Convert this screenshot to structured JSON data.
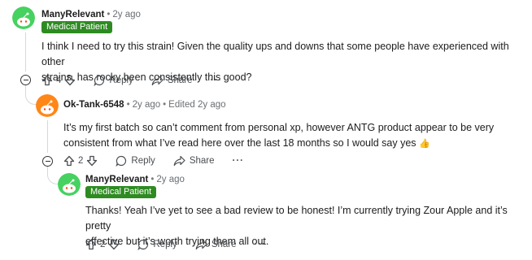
{
  "comments": [
    {
      "username": "ManyRelevant",
      "separator": "•",
      "time": "2y ago",
      "flair": "Medical Patient",
      "text_lines": [
        "I think I need to try this strain! Given the quality ups and downs that some people have experienced with other",
        "strains, has rocky been consistently this good?"
      ],
      "votes": "4",
      "reply_label": "Reply",
      "share_label": "Share",
      "more_label": "···",
      "avatar_color": "#46d160"
    },
    {
      "username": "Ok-Tank-6548",
      "separator": "•",
      "time": "2y ago",
      "edited": "Edited 2y ago",
      "text_lines": [
        "It’s my first batch so can’t comment from personal xp, however ANTG product appear to be very",
        "consistent from what I’ve read here over the last 18 months so I would say yes"
      ],
      "emoji": "👍",
      "votes": "2",
      "reply_label": "Reply",
      "share_label": "Share",
      "more_label": "···",
      "avatar_color": "#ff8717"
    },
    {
      "username": "ManyRelevant",
      "separator": "•",
      "time": "2y ago",
      "flair": "Medical Patient",
      "text_lines": [
        "Thanks! Yeah I’ve yet to see a bad review to be honest! I’m currently trying Zour Apple and it’s pretty",
        "effective but it’s worth trying them all out."
      ],
      "votes": "2",
      "reply_label": "Reply",
      "share_label": "Share",
      "more_label": "···",
      "avatar_color": "#46d160"
    }
  ],
  "colors": {
    "flair_bg": "#2e8b22",
    "thread_line": "#d5d9dc",
    "muted": "#6a6f73"
  }
}
